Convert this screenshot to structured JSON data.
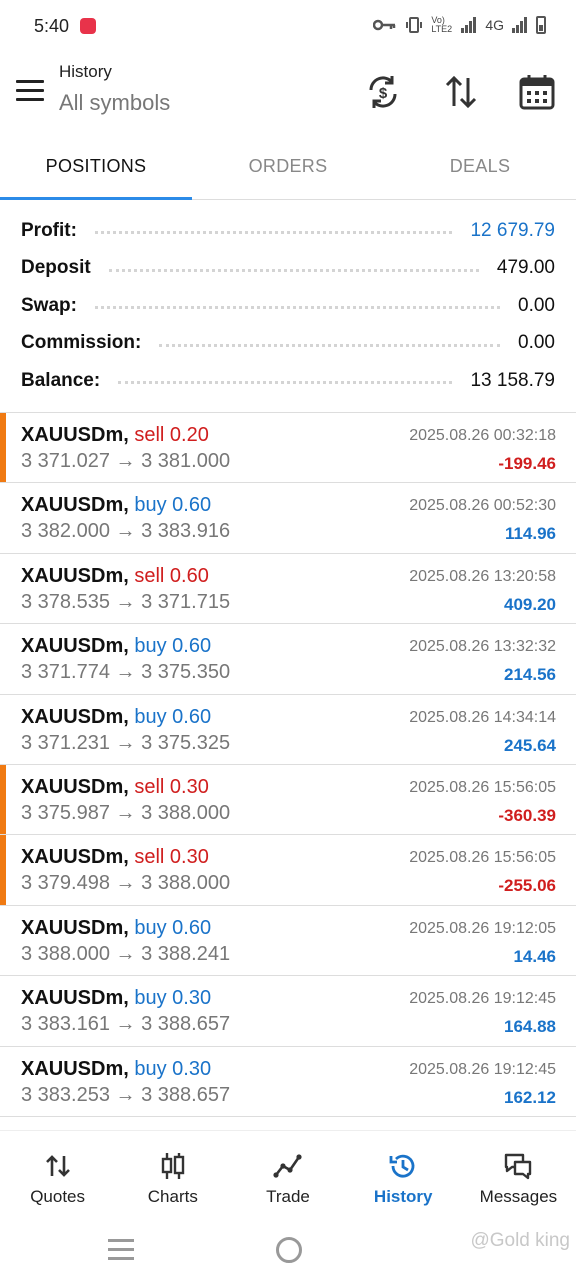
{
  "status_bar": {
    "time": "5:40",
    "network_text": "Vo) LTE2",
    "network_type": "4G"
  },
  "header": {
    "title": "History",
    "subtitle": "All symbols"
  },
  "tabs": [
    {
      "label": "POSITIONS",
      "active": true
    },
    {
      "label": "ORDERS",
      "active": false
    },
    {
      "label": "DEALS",
      "active": false
    }
  ],
  "summary": {
    "profit_label": "Profit:",
    "profit": "12 679.79",
    "deposit_label": "Deposit",
    "deposit": "479.00",
    "swap_label": "Swap:",
    "swap": "0.00",
    "commission_label": "Commission:",
    "commission": "0.00",
    "balance_label": "Balance:",
    "balance": "13 158.79"
  },
  "deals": [
    {
      "symbol": "XAUUSDm,",
      "type": "sell 0.20",
      "side": "sell",
      "time": "2025.08.26 00:32:18",
      "prices": "3 371.027 → 3 381.000",
      "profit": "-199.46"
    },
    {
      "symbol": "XAUUSDm,",
      "type": "buy 0.60",
      "side": "buy",
      "time": "2025.08.26 00:52:30",
      "prices": "3 382.000 → 3 383.916",
      "profit": "114.96"
    },
    {
      "symbol": "XAUUSDm,",
      "type": "sell 0.60",
      "side": "sell",
      "time": "2025.08.26 13:20:58",
      "prices": "3 378.535 → 3 371.715",
      "profit": "409.20"
    },
    {
      "symbol": "XAUUSDm,",
      "type": "buy 0.60",
      "side": "buy",
      "time": "2025.08.26 13:32:32",
      "prices": "3 371.774 → 3 375.350",
      "profit": "214.56"
    },
    {
      "symbol": "XAUUSDm,",
      "type": "buy 0.60",
      "side": "buy",
      "time": "2025.08.26 14:34:14",
      "prices": "3 371.231 → 3 375.325",
      "profit": "245.64"
    },
    {
      "symbol": "XAUUSDm,",
      "type": "sell 0.30",
      "side": "sell",
      "time": "2025.08.26 15:56:05",
      "prices": "3 375.987 → 3 388.000",
      "profit": "-360.39"
    },
    {
      "symbol": "XAUUSDm,",
      "type": "sell 0.30",
      "side": "sell",
      "time": "2025.08.26 15:56:05",
      "prices": "3 379.498 → 3 388.000",
      "profit": "-255.06"
    },
    {
      "symbol": "XAUUSDm,",
      "type": "buy 0.60",
      "side": "buy",
      "time": "2025.08.26 19:12:05",
      "prices": "3 388.000 → 3 388.241",
      "profit": "14.46"
    },
    {
      "symbol": "XAUUSDm,",
      "type": "buy 0.30",
      "side": "buy",
      "time": "2025.08.26 19:12:45",
      "prices": "3 383.161 → 3 388.657",
      "profit": "164.88"
    },
    {
      "symbol": "XAUUSDm,",
      "type": "buy 0.30",
      "side": "buy",
      "time": "2025.08.26 19:12:45",
      "prices": "3 383.253 → 3 388.657",
      "profit": "162.12"
    }
  ],
  "bottom_nav": [
    {
      "label": "Quotes",
      "icon": "quotes-arrows-icon",
      "active": false
    },
    {
      "label": "Charts",
      "icon": "candlestick-icon",
      "active": false
    },
    {
      "label": "Trade",
      "icon": "trade-line-icon",
      "active": false
    },
    {
      "label": "History",
      "icon": "history-clock-icon",
      "active": true
    },
    {
      "label": "Messages",
      "icon": "chat-bubbles-icon",
      "active": false
    }
  ],
  "watermark": "@Gold king",
  "colors": {
    "accent_blue": "#1a73c9",
    "loss_red": "#d01e1e",
    "loss_flag_orange": "#f07a12",
    "tab_indicator": "#2b8be8"
  }
}
